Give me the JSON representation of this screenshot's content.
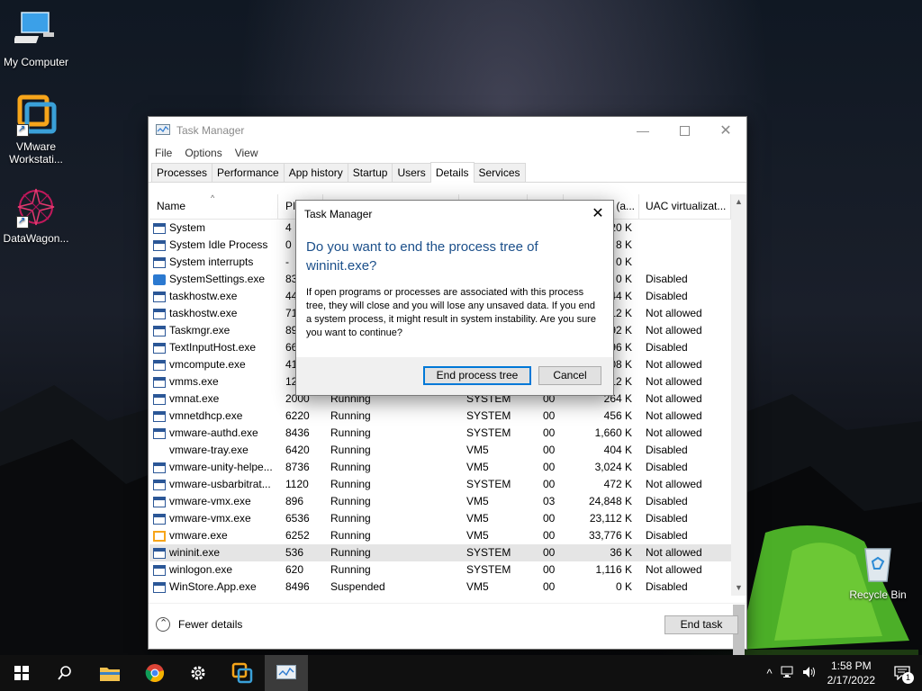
{
  "desktop": {
    "icons": [
      {
        "label": "My Computer"
      },
      {
        "label": "VMware Workstati..."
      },
      {
        "label": "DataWagon..."
      },
      {
        "label": "Recycle Bin"
      }
    ]
  },
  "task_manager": {
    "title": "Task Manager",
    "menu": [
      "File",
      "Options",
      "View"
    ],
    "tabs": [
      "Processes",
      "Performance",
      "App history",
      "Startup",
      "Users",
      "Details",
      "Services"
    ],
    "active_tab": "Details",
    "columns": {
      "name": "Name",
      "pid": "PI",
      "mem": "y (a...",
      "uac": "UAC virtualizat..."
    },
    "rows": [
      {
        "name": "System",
        "pid": "4",
        "status": "",
        "user": "",
        "cpu": "",
        "mem": "20 K",
        "uac": "",
        "icon": "window"
      },
      {
        "name": "System Idle Process",
        "pid": "0",
        "status": "",
        "user": "",
        "cpu": "",
        "mem": "8 K",
        "uac": "",
        "icon": "window"
      },
      {
        "name": "System interrupts",
        "pid": "-",
        "status": "",
        "user": "",
        "cpu": "",
        "mem": "0 K",
        "uac": "",
        "icon": "window"
      },
      {
        "name": "SystemSettings.exe",
        "pid": "83",
        "status": "",
        "user": "",
        "cpu": "",
        "mem": "0 K",
        "uac": "Disabled",
        "icon": "gear"
      },
      {
        "name": "taskhostw.exe",
        "pid": "44",
        "status": "",
        "user": "",
        "cpu": "",
        "mem": "44 K",
        "uac": "Disabled",
        "icon": "window"
      },
      {
        "name": "taskhostw.exe",
        "pid": "71",
        "status": "",
        "user": "",
        "cpu": "",
        "mem": "12 K",
        "uac": "Not allowed",
        "icon": "window"
      },
      {
        "name": "Taskmgr.exe",
        "pid": "89",
        "status": "",
        "user": "",
        "cpu": "",
        "mem": "92 K",
        "uac": "Not allowed",
        "icon": "taskmgr"
      },
      {
        "name": "TextInputHost.exe",
        "pid": "66",
        "status": "",
        "user": "",
        "cpu": "",
        "mem": "96 K",
        "uac": "Disabled",
        "icon": "window"
      },
      {
        "name": "vmcompute.exe",
        "pid": "41",
        "status": "",
        "user": "",
        "cpu": "",
        "mem": "08 K",
        "uac": "Not allowed",
        "icon": "window"
      },
      {
        "name": "vmms.exe",
        "pid": "12",
        "status": "",
        "user": "",
        "cpu": "",
        "mem": "12 K",
        "uac": "Not allowed",
        "icon": "window"
      },
      {
        "name": "vmnat.exe",
        "pid": "2000",
        "status": "Running",
        "user": "SYSTEM",
        "cpu": "00",
        "mem": "264 K",
        "uac": "Not allowed",
        "icon": "window"
      },
      {
        "name": "vmnetdhcp.exe",
        "pid": "6220",
        "status": "Running",
        "user": "SYSTEM",
        "cpu": "00",
        "mem": "456 K",
        "uac": "Not allowed",
        "icon": "window"
      },
      {
        "name": "vmware-authd.exe",
        "pid": "8436",
        "status": "Running",
        "user": "SYSTEM",
        "cpu": "00",
        "mem": "1,660 K",
        "uac": "Not allowed",
        "icon": "window"
      },
      {
        "name": "vmware-tray.exe",
        "pid": "6420",
        "status": "Running",
        "user": "VM5",
        "cpu": "00",
        "mem": "404 K",
        "uac": "Disabled",
        "icon": "blank"
      },
      {
        "name": "vmware-unity-helpe...",
        "pid": "8736",
        "status": "Running",
        "user": "VM5",
        "cpu": "00",
        "mem": "3,024 K",
        "uac": "Disabled",
        "icon": "window"
      },
      {
        "name": "vmware-usbarbitrat...",
        "pid": "1120",
        "status": "Running",
        "user": "SYSTEM",
        "cpu": "00",
        "mem": "472 K",
        "uac": "Not allowed",
        "icon": "window"
      },
      {
        "name": "vmware-vmx.exe",
        "pid": "896",
        "status": "Running",
        "user": "VM5",
        "cpu": "03",
        "mem": "24,848 K",
        "uac": "Disabled",
        "icon": "window"
      },
      {
        "name": "vmware-vmx.exe",
        "pid": "6536",
        "status": "Running",
        "user": "VM5",
        "cpu": "00",
        "mem": "23,112 K",
        "uac": "Disabled",
        "icon": "window"
      },
      {
        "name": "vmware.exe",
        "pid": "6252",
        "status": "Running",
        "user": "VM5",
        "cpu": "00",
        "mem": "33,776 K",
        "uac": "Disabled",
        "icon": "vmware"
      },
      {
        "name": "wininit.exe",
        "pid": "536",
        "status": "Running",
        "user": "SYSTEM",
        "cpu": "00",
        "mem": "36 K",
        "uac": "Not allowed",
        "icon": "window",
        "selected": true
      },
      {
        "name": "winlogon.exe",
        "pid": "620",
        "status": "Running",
        "user": "SYSTEM",
        "cpu": "00",
        "mem": "1,116 K",
        "uac": "Not allowed",
        "icon": "window"
      },
      {
        "name": "WinStore.App.exe",
        "pid": "8496",
        "status": "Suspended",
        "user": "VM5",
        "cpu": "00",
        "mem": "0 K",
        "uac": "Disabled",
        "icon": "window"
      }
    ],
    "fewer_details": "Fewer details",
    "end_task": "End task"
  },
  "dialog": {
    "title": "Task Manager",
    "heading": "Do you want to end the process tree of wininit.exe?",
    "body": "If open programs or processes are associated with this process tree, they will close and you will lose any unsaved data. If you end a system process, it might result in system instability. Are you sure you want to continue?",
    "confirm_label": "End process tree",
    "cancel_label": "Cancel"
  },
  "taskbar": {
    "time": "1:58 PM",
    "date": "2/17/2022",
    "notification_count": "1",
    "apps": [
      "start-icon",
      "search-icon",
      "file-explorer-icon",
      "chrome-icon",
      "settings-icon",
      "vmware-icon",
      "task-manager-icon"
    ]
  },
  "colors": {
    "accent": "#0078d7",
    "dialog_heading": "#1b4f8a",
    "selected_row": "#e5e5e5"
  }
}
